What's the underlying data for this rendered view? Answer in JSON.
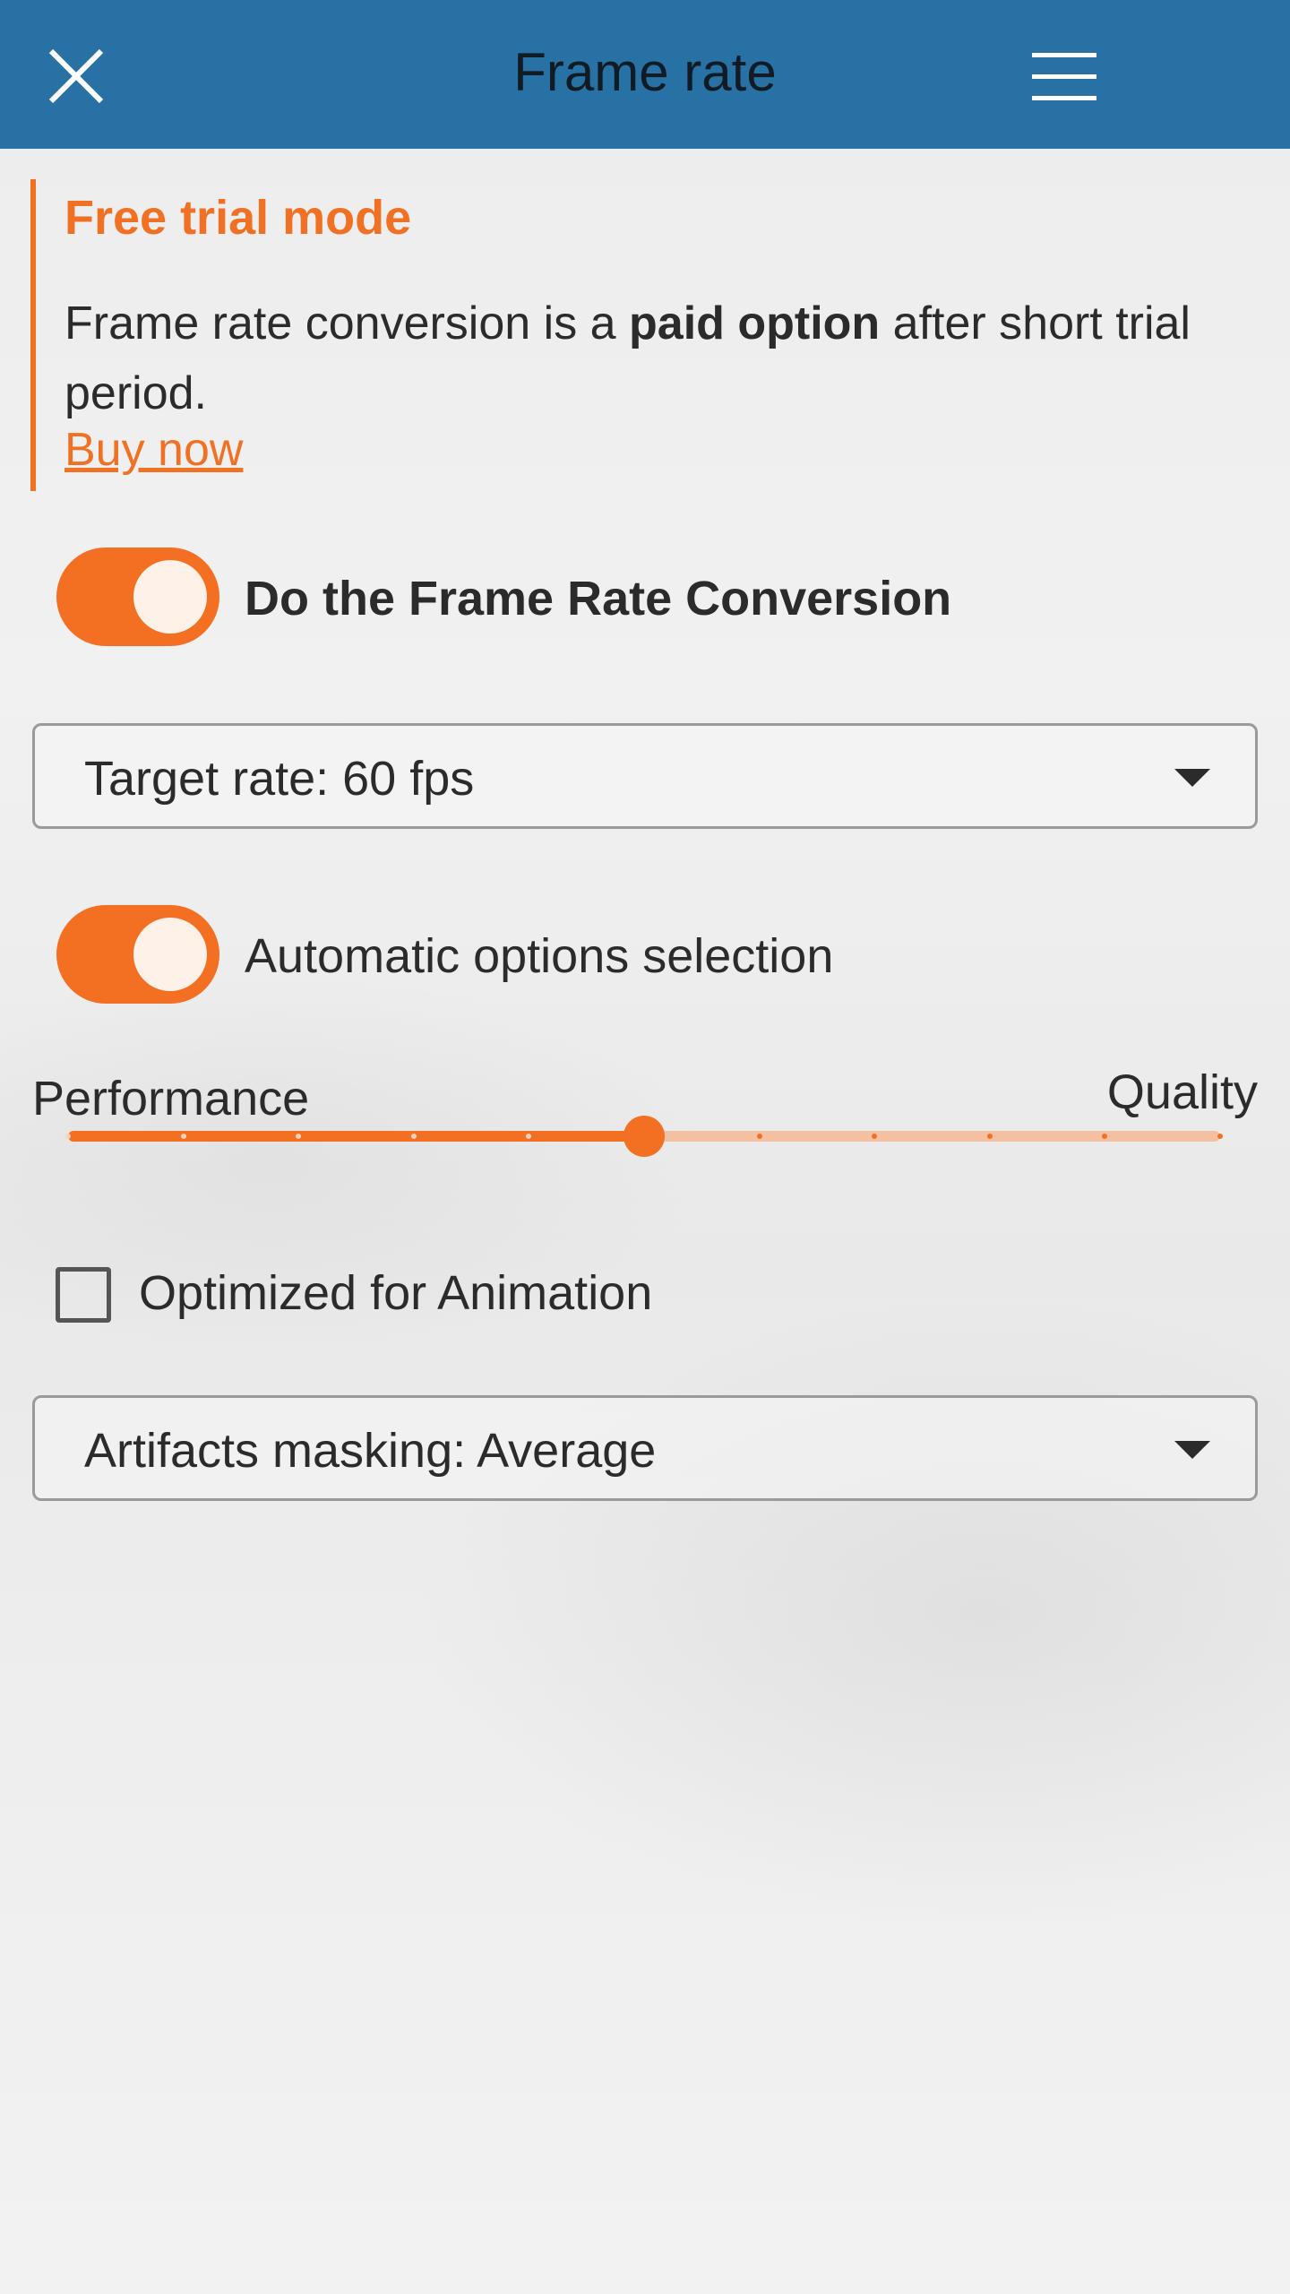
{
  "header": {
    "title": "Frame rate",
    "close_icon": "close-icon",
    "menu_icon": "hamburger-menu-icon",
    "background_color": "#2771a5"
  },
  "trial": {
    "title": "Free trial mode",
    "text_before": "Frame rate conversion is a ",
    "text_bold": "paid option",
    "text_after": " after short trial period.",
    "buy_link": "Buy now",
    "accent_color": "#f07024"
  },
  "conversion_toggle": {
    "label": "Do the Frame Rate Conversion",
    "on": true
  },
  "target_rate_select": {
    "value": "Target rate: 60 fps"
  },
  "auto_options_toggle": {
    "label": "Automatic options selection",
    "on": true
  },
  "quality_slider": {
    "left_label": "Performance",
    "right_label": "Quality",
    "steps": 10,
    "value": 5
  },
  "animation_checkbox": {
    "label": "Optimized for Animation",
    "checked": false
  },
  "artifacts_select": {
    "value": "Artifacts masking: Average"
  }
}
